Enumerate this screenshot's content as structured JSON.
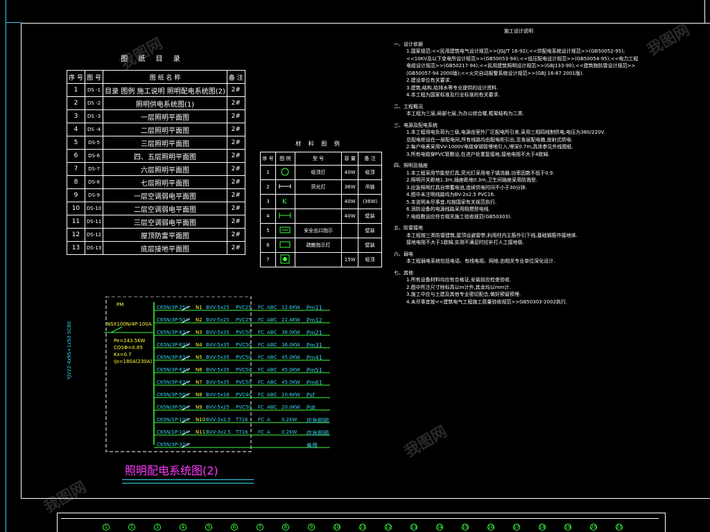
{
  "index_title": "图 纸 目 录",
  "index_headers": [
    "序 号",
    "图 号",
    "图 纸 名 称",
    "备 注"
  ],
  "index_rows": [
    {
      "no": "1",
      "code": "DS -1",
      "name": "目录 图例 施工说明 照明配电系统图(2)",
      "note": "2#"
    },
    {
      "no": "2",
      "code": "DS -2",
      "name": "照明供电系统图(1)",
      "note": "2#"
    },
    {
      "no": "3",
      "code": "DS -3",
      "name": "一层照明平面图",
      "note": "2#"
    },
    {
      "no": "4",
      "code": "DS -4",
      "name": "二层照明平面图",
      "note": "2#"
    },
    {
      "no": "5",
      "code": "DS-5",
      "name": "三层照明平面图",
      "note": "2#"
    },
    {
      "no": "6",
      "code": "DS-6",
      "name": "四、五层照明平面图",
      "note": "2#"
    },
    {
      "no": "7",
      "code": "DS-7",
      "name": "六层照明平面图",
      "note": "2#"
    },
    {
      "no": "8",
      "code": "DS-8",
      "name": "七层照明平面图",
      "note": "2#"
    },
    {
      "no": "9",
      "code": "DS-9",
      "name": "一层空调弱电平面图",
      "note": "2#"
    },
    {
      "no": "10",
      "code": "DS-10",
      "name": "二层空调弱电平面图",
      "note": "2#"
    },
    {
      "no": "11",
      "code": "DS-11",
      "name": "三层空调弱电平面图",
      "note": "2#"
    },
    {
      "no": "12",
      "code": "DS-12",
      "name": "屋顶防雷平面图",
      "note": "2#"
    },
    {
      "no": "13",
      "code": "DS-13",
      "name": "底层接地平面图",
      "note": "2#"
    }
  ],
  "legend_title": "材 料 图 例",
  "legend_headers": [
    "序 号",
    "图 例",
    "型 号",
    "容 量",
    "备 注"
  ],
  "legend_rows": [
    {
      "no": "1",
      "model": "吸顶灯",
      "cap": "40W",
      "note": "吸顶"
    },
    {
      "no": "2",
      "model": "荧光灯",
      "cap": "36W",
      "note": "吊链"
    },
    {
      "no": "3",
      "model": "",
      "cap": "40W",
      "note": "(36W)"
    },
    {
      "no": "4",
      "model": "",
      "cap": "40W",
      "note": "壁装"
    },
    {
      "no": "5",
      "model": "安全出口指示",
      "cap": "",
      "note": "壁装"
    },
    {
      "no": "6",
      "model": "疏散指示灯",
      "cap": "",
      "note": "壁装"
    },
    {
      "no": "7",
      "model": "",
      "cap": "15W",
      "note": "吸顶"
    }
  ],
  "system": {
    "title": "照明配电系统图(2)",
    "panel_label": "PM",
    "incoming_breaker": "NSX100N/4P-100A",
    "params": [
      "Pe=243.5KW",
      "COSΦ=0.85",
      "Kx=0.7",
      "Ijs=180A(230A)"
    ],
    "feeder_cable": "YJV22-4x95+1x50 SC80",
    "circuits": [
      {
        "br": "C65N/3P-25A",
        "n": "N1",
        "cable": "BVV-5x25",
        "pipe": "PVC25",
        "f": "FC",
        "w": "ABC",
        "kw": "12.6KW",
        "dest": "Pm11"
      },
      {
        "br": "C65N/3P-50A",
        "n": "N2",
        "cable": "BVV-5x25",
        "pipe": "PVC25",
        "f": "FC",
        "w": "ABC",
        "kw": "22.4KW",
        "dest": "Pm12"
      },
      {
        "br": "C65N/3P-63A",
        "n": "N3",
        "cable": "BVV-5x35",
        "pipe": "PVC50",
        "f": "FC",
        "w": "ABC",
        "kw": "36.0KW",
        "dest": "Pm21"
      },
      {
        "br": "C65N/3P-63A",
        "n": "N4",
        "cable": "BVV-5x35",
        "pipe": "PVC50",
        "f": "FC",
        "w": "ABC",
        "kw": "36.0KW",
        "dest": "Pm31"
      },
      {
        "br": "C65N/3P-63A",
        "n": "N5",
        "cable": "BVV-5x35",
        "pipe": "PVC50",
        "f": "FC",
        "w": "ABC",
        "kw": "45.0KW",
        "dest": "Pm41"
      },
      {
        "br": "C65N/3P-63A",
        "n": "N6",
        "cable": "BVV-5x35",
        "pipe": "PVC50",
        "f": "FC",
        "w": "ABC",
        "kw": "45.0KW",
        "dest": "Pm51"
      },
      {
        "br": "C65N/3P-63A",
        "n": "N7",
        "cable": "BVV-5x35",
        "pipe": "PVC50",
        "f": "FC",
        "w": "ABC",
        "kw": "45.0KW",
        "dest": "Pm61"
      },
      {
        "br": "C65N/3P-50A",
        "n": "N8",
        "cable": "BVV-5x16",
        "pipe": "PVC40",
        "f": "FC",
        "w": "ABC",
        "kw": "10.6KW",
        "dest": "Psf"
      },
      {
        "br": "C65N/3P-50A",
        "n": "N9",
        "cable": "BVV-5x25",
        "pipe": "PVC50",
        "f": "FC",
        "w": "ABC",
        "kw": "20.0KW",
        "dest": "Pdt"
      },
      {
        "br": "C65N/1P-10A",
        "n": "N10",
        "cable": "BVV-3x2.5",
        "pipe": "T716",
        "f": "FC",
        "w": "A",
        "kw": "0.2KW",
        "dest": "应急照明"
      },
      {
        "br": "C65N/1P-10A",
        "n": "N11",
        "cable": "BVV-3x2.5",
        "pipe": "T716",
        "f": "FC",
        "w": "A",
        "kw": "0.2KW",
        "dest": "应急照明"
      },
      {
        "br": "C65N/3P-32A",
        "n": "",
        "cable": "",
        "pipe": "",
        "f": "",
        "w": "",
        "kw": "",
        "dest": "备用"
      }
    ]
  },
  "notes": {
    "title": "施工设计说明",
    "lines": [
      "一、设计依据",
      "1.国家规范:<<民用建筑电气设计规范>>(JGJ/T 16-92);<<供配电系统设计规范>>(GB50052-95);",
      "<<10KV及以下变电所设计规范>>(GB50053-94);<<低压配电设计规范>>(GB50054-95);<<电力工程",
      "电缆设计规范>>(GB50217-94);<<民用建筑照明设计规范>>(GBJ133-90);<<建筑物防雷设计规范>>",
      "(GB50057-94 2000版);<<火灾自动报警系统设计规范>>(GBJ 16-87 2001版).",
      "2.建设单位有关要求.",
      "3.建筑,结构,给排水等专业提供的设计资料.",
      "4.本工程为国家标准及行业标准的有关要求.",
      "二、工程概况",
      "本工程为三层,局部七层,为办公综合楼,框架结构为二类.",
      "三、电源及配电系统",
      "1.本工程用电负荷为三级,电源由室外厂区配电所引来,采用三相四线制供电,电压为380/220V.",
      "总配电柜设在一层配电间,所有线路均由配电柜引出,至各层配电箱,放射式供电.",
      "2.每户电表采用VV-1000V电缆穿钢管埋地引入,埋深0.7m,具体参见外线图纸.",
      "3.所有电缆穿PVC管敷设,在进户处重复接地,接地电阻不大于4欧姆.",
      "四、照明及插座",
      "1.本工程采用节能型灯具,荧光灯采用电子镇流器,功率因数不低于0.9.",
      "2.照明开关距地1.3m,插座距地0.3m,卫生间插座采用防溅型.",
      "3.应急照明灯具自带蓄电池,连续供电时间不小于30分钟.",
      "4.图中未注明线路均为BV-2x2.5 PVC16.",
      "5.本说明未尽事宜,均按国家有关规范执行.",
      "6.消防设备的电源线路采用阻燃型电线.",
      "7.电缆敷设应符合相关施工验收规范(GB50303).",
      "五、防雷接地",
      "本工程按三类防雷建筑,屋顶设避雷带,利用柱内主筋作引下线,基础钢筋作接地体.",
      "接地电阻不大于1欧姆,实测不满足时应补打人工接地极.",
      "六、弱电",
      "本工程弱电系统包括电话、有线电视、网络,由相关专业单位深化设计.",
      "七、其他",
      "1.所有设备材料均应有合格证,安装前应检查验收.",
      "2.图中所注尺寸除标高以m计外,其余均以mm计.",
      "3.施工中应与土建及其他专业密切配合,做好预留预埋.",
      "4.未尽事宜按<<建筑电气工程施工质量验收规范>>GB50303-2002执行."
    ]
  },
  "axis_labels": [
    "1",
    "2",
    "3",
    "4",
    "5",
    "6",
    "7",
    "8",
    "9",
    "10",
    "11",
    "12",
    "13",
    "14",
    "15",
    "16",
    "17",
    "18",
    "19",
    "20",
    "21"
  ]
}
